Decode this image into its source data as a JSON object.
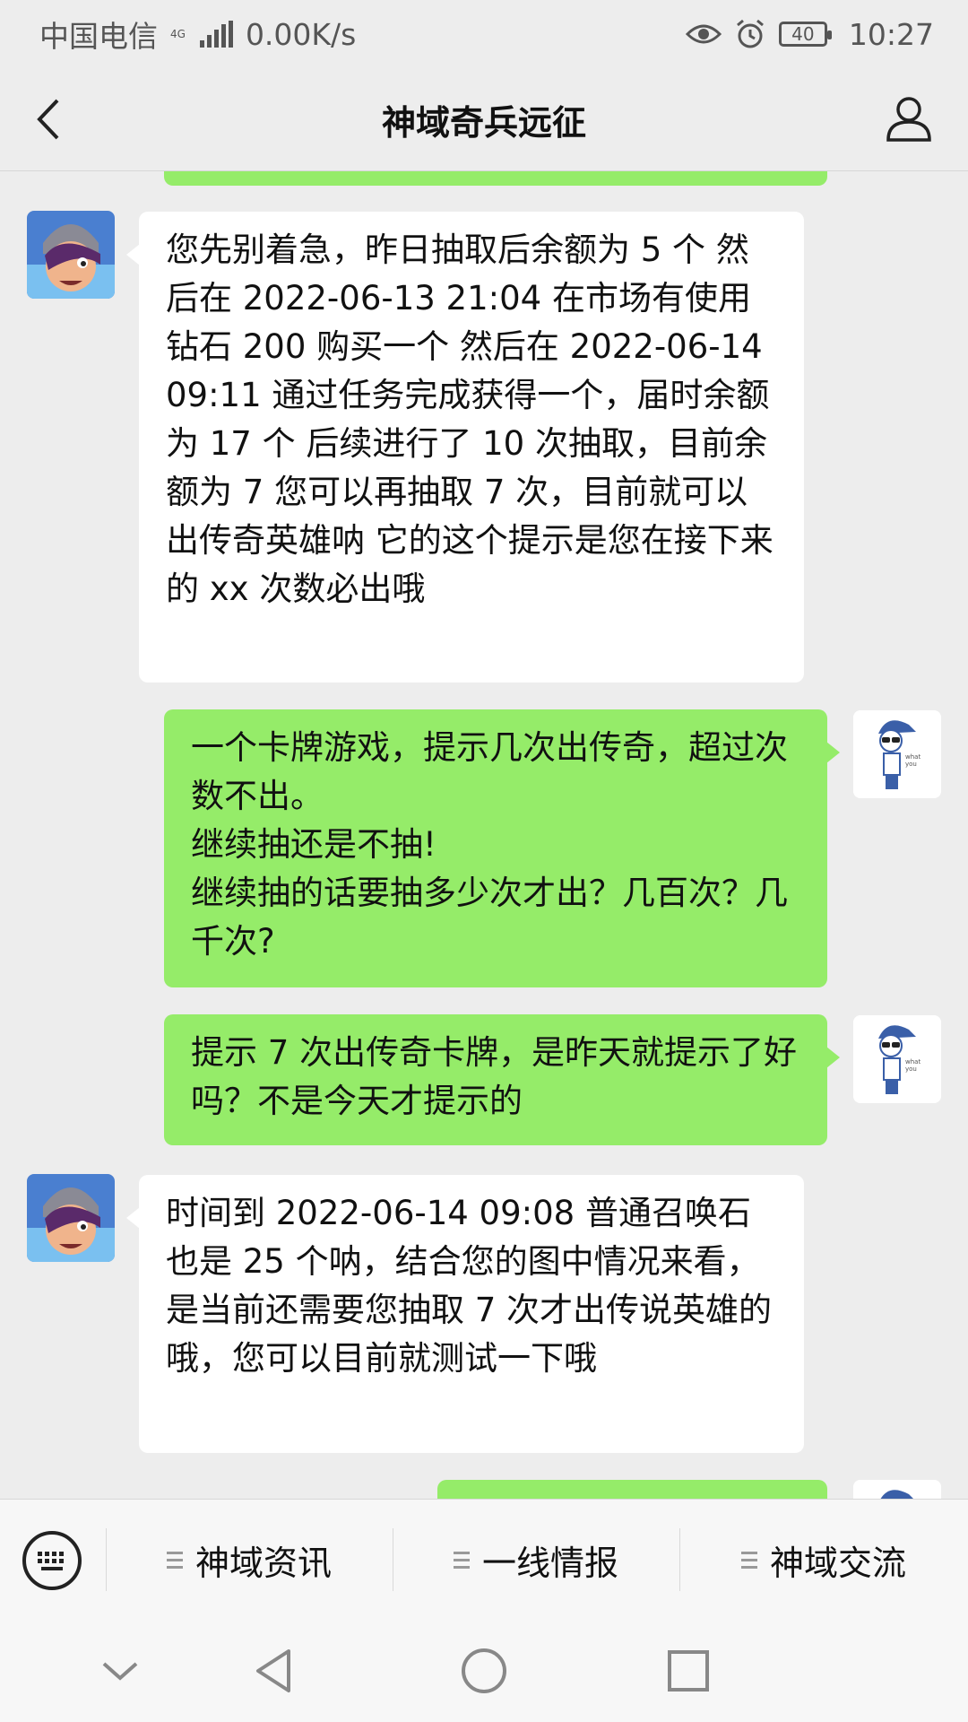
{
  "status_bar": {
    "carrier": "中国电信",
    "network": "4G",
    "speed": "0.00K/s",
    "battery": "40",
    "time": "10:27"
  },
  "header": {
    "title": "神域奇兵远征"
  },
  "messages": [
    {
      "side": "in",
      "text": "您先别着急，昨日抽取后余额为 5 个 然后在 2022-06-13 21:04 在市场有使用钻石 200 购买一个 然后在 2022-06-14 09:11 通过任务完成获得一个，届时余额为 17 个 后续进行了 10 次抽取，目前余额为 7 您可以再抽取 7 次，目前就可以出传奇英雄呐 它的这个提示是您在接下来的 xx 次数必出哦"
    },
    {
      "side": "out",
      "text": "一个卡牌游戏，提示几次出传奇，超过次数不出。\n继续抽还是不抽!\n继续抽的话要抽多少次才出？几百次？几千次?"
    },
    {
      "side": "out",
      "text": "提示 7 次出传奇卡牌，是昨天就提示了好吗？不是今天才提示的"
    },
    {
      "side": "in",
      "text": "时间到 2022-06-14 09:08 普通召唤石也是 25 个呐，结合您的图中情况来看，是当前还需要您抽取 7 次才出传说英雄的哦，您可以目前就测试一下哦"
    }
  ],
  "menu": {
    "items": [
      {
        "label": "神域资讯"
      },
      {
        "label": "一线情报"
      },
      {
        "label": "神域交流"
      }
    ]
  },
  "colors": {
    "out_bubble": "#95ec69",
    "in_bubble": "#ffffff",
    "background": "#ededed"
  }
}
